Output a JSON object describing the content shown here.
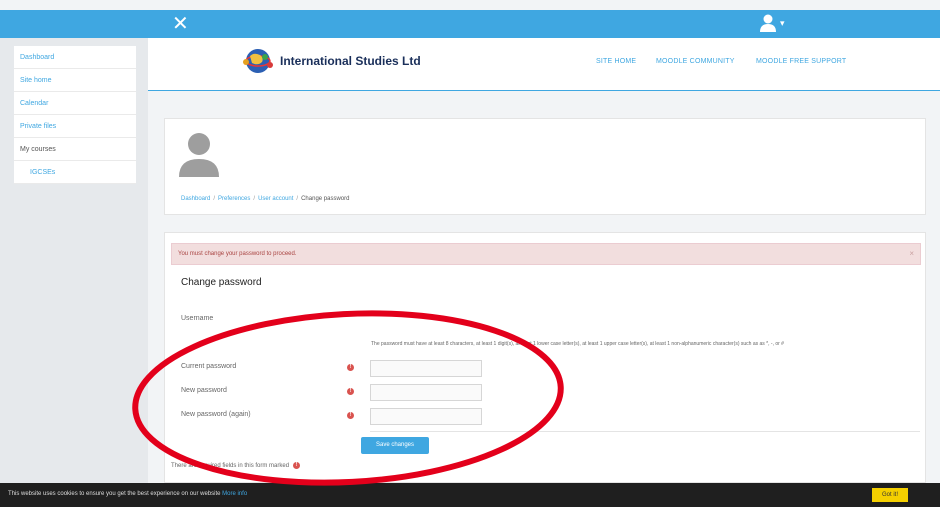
{
  "colors": {
    "accent": "#3fa7e1",
    "annotation": "#e3001b",
    "cookie_button": "#f5d000"
  },
  "topbar": {
    "close_glyph": "✕",
    "caret": "▾"
  },
  "sidebar": {
    "items": [
      {
        "label": "Dashboard"
      },
      {
        "label": "Site home"
      },
      {
        "label": "Calendar"
      },
      {
        "label": "Private files"
      },
      {
        "label": "My courses"
      },
      {
        "label": "IGCSEs"
      }
    ]
  },
  "header": {
    "brand": "International Studies Ltd",
    "nav": [
      "SITE HOME",
      "MOODLE COMMUNITY",
      "MOODLE FREE SUPPORT"
    ]
  },
  "breadcrumb": [
    "Dashboard",
    "Preferences",
    "User account",
    "Change password"
  ],
  "form": {
    "alert": "You must change your password to proceed.",
    "alert_close": "×",
    "title": "Change password",
    "username_label": "Username",
    "password_hint": "The password must have at least 8 characters, at least 1 digit(s), at least 1 lower case letter(s), at least 1 upper case letter(s), at least 1 non-alphanumeric character(s) such as as *, -, or #",
    "fields": [
      {
        "label": "Current password",
        "value": ""
      },
      {
        "label": "New password",
        "value": ""
      },
      {
        "label": "New password (again)",
        "value": ""
      }
    ],
    "submit_label": "Save changes",
    "required_note": "There are required fields in this form marked",
    "required_glyph": "!"
  },
  "cookie": {
    "text": "This website uses cookies to ensure you get the best experience on our website",
    "more": "More info",
    "button": "Got it!"
  }
}
